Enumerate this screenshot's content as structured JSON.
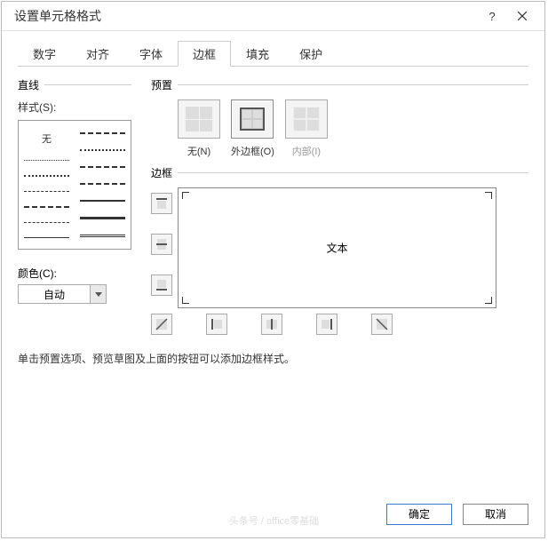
{
  "title": "设置单元格格式",
  "tabs": [
    "数字",
    "对齐",
    "字体",
    "边框",
    "填充",
    "保护"
  ],
  "left": {
    "section": "直线",
    "style_label": "样式(S):",
    "none": "无",
    "color_label": "颜色(C):",
    "color_value": "自动"
  },
  "right": {
    "preset_section": "预置",
    "presets": [
      "无(N)",
      "外边框(O)",
      "内部(I)"
    ],
    "border_section": "边框",
    "preview_text": "文本"
  },
  "hint": "单击预置选项、预览草图及上面的按钮可以添加边框样式。",
  "footer": {
    "ok": "确定",
    "cancel": "取消"
  },
  "watermark": "头条号 / office零基础"
}
